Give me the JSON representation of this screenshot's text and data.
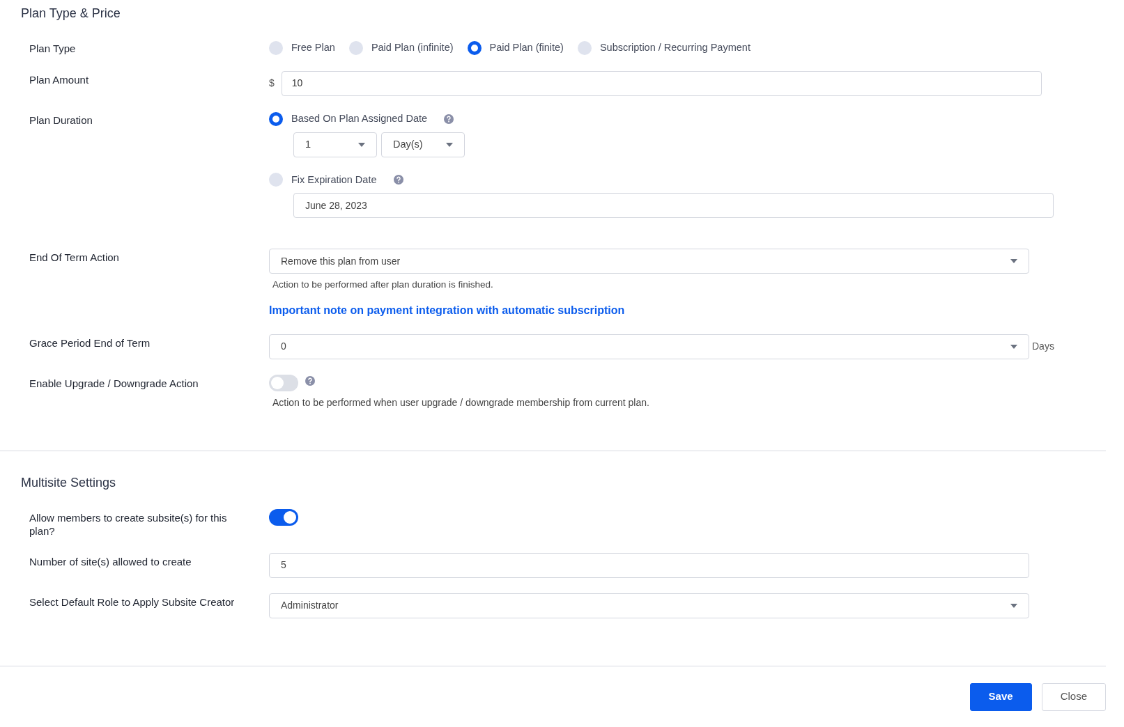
{
  "sections": [
    {
      "title": "Plan Type & Price",
      "rows": [
        {
          "kind": "radios",
          "label": "Plan Type",
          "options": [
            {
              "label": "Free Plan",
              "selected": false
            },
            {
              "label": "Paid Plan (infinite)",
              "selected": false
            },
            {
              "label": "Paid Plan (finite)",
              "selected": true
            },
            {
              "label": "Subscription / Recurring Payment",
              "selected": false
            }
          ]
        },
        {
          "kind": "amount",
          "label": "Plan Amount",
          "prefix": "$",
          "value": "10"
        },
        {
          "kind": "duration",
          "label": "Plan Duration",
          "options": [
            {
              "label": "Based On Plan Assigned Date",
              "selected": true,
              "help_icon": true,
              "selects": [
                "1",
                "Day(s)"
              ]
            },
            {
              "label": "Fix Expiration Date",
              "selected": false,
              "help_icon": true,
              "value": "June 28, 2023"
            }
          ]
        },
        {
          "kind": "select",
          "label": "End Of Term Action",
          "value": "Remove this plan from user",
          "help": "Action to be performed after plan duration is finished.",
          "link": "Important note on payment integration with automatic subscription"
        },
        {
          "kind": "select",
          "label": "Grace Period End of Term",
          "value": "0",
          "suffix": "Days"
        },
        {
          "kind": "toggle",
          "label": "Enable Upgrade / Downgrade Action",
          "on": false,
          "help_icon": true,
          "help": "Action to be performed when user upgrade / downgrade membership from current plan."
        }
      ]
    },
    {
      "title": "Multisite Settings",
      "rows": [
        {
          "kind": "toggle",
          "label": "Allow members to create subsite(s) for this plan?",
          "on": true
        },
        {
          "kind": "input",
          "label": "Number of site(s) allowed to create",
          "value": "5"
        },
        {
          "kind": "select",
          "label": "Select Default Role to Apply Subsite Creator",
          "value": "Administrator"
        }
      ]
    }
  ],
  "buttons": [
    {
      "label": "Save",
      "kind": "primary"
    },
    {
      "label": "Close",
      "kind": "secondary"
    }
  ]
}
